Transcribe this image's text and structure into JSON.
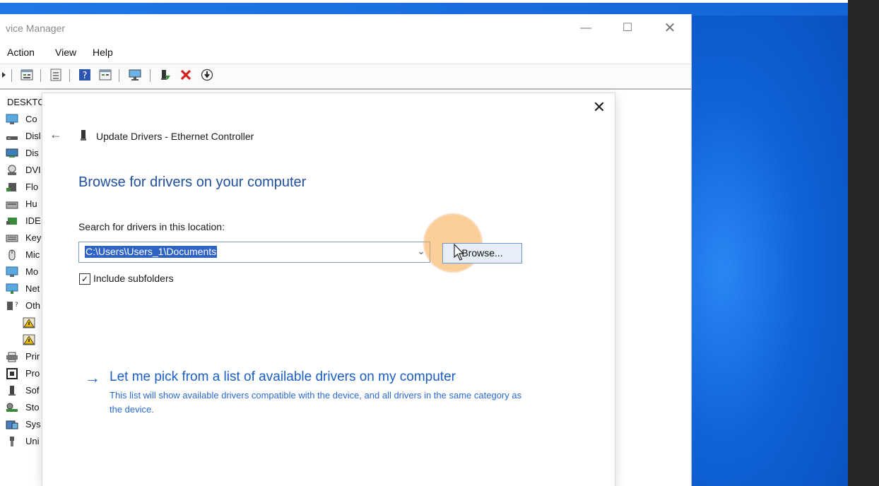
{
  "window": {
    "title": "vice Manager",
    "controls": {
      "minimize": "—",
      "maximize": "☐",
      "close": "✕"
    }
  },
  "menu": [
    "Action",
    "View",
    "Help"
  ],
  "toolbar": {
    "icons": [
      "back-icon",
      "properties-icon",
      "tree-icon",
      "help-icon",
      "grid-icon",
      "monitor-icon",
      "enable-device-icon",
      "uninstall-device-icon",
      "update-driver-icon"
    ]
  },
  "tree": {
    "root": "DESKTC",
    "items": [
      "Co",
      "Disl",
      "Dis",
      "DVI",
      "Flo",
      "Hu",
      "IDE",
      "Key",
      "Mic",
      "Mo",
      "Net",
      "Oth",
      "",
      "",
      "Prir",
      "Pro",
      "Sof",
      "Sto",
      "Sys",
      "Uni"
    ]
  },
  "dialog": {
    "close": "✕",
    "back": "←",
    "header": "Update Drivers - Ethernet Controller",
    "heading": "Browse for drivers on your computer",
    "search_label": "Search for drivers in this location:",
    "path_value": "C:\\Users\\Users_1\\Documents",
    "dropdown_glyph": "⌄",
    "browse_label": "Browse...",
    "include_subfolders_label": "Include subfolders",
    "include_subfolders_checked": true,
    "pick": {
      "arrow": "→",
      "title": "Let me pick from a list of available drivers on my computer",
      "description": "This list will show available drivers compatible with the device, and all drivers in the same category as the device."
    }
  },
  "colors": {
    "accent": "#1f4f9e",
    "link": "#1a5ec4",
    "highlight": "#f5a546",
    "desktop": "#0a5fd0"
  }
}
